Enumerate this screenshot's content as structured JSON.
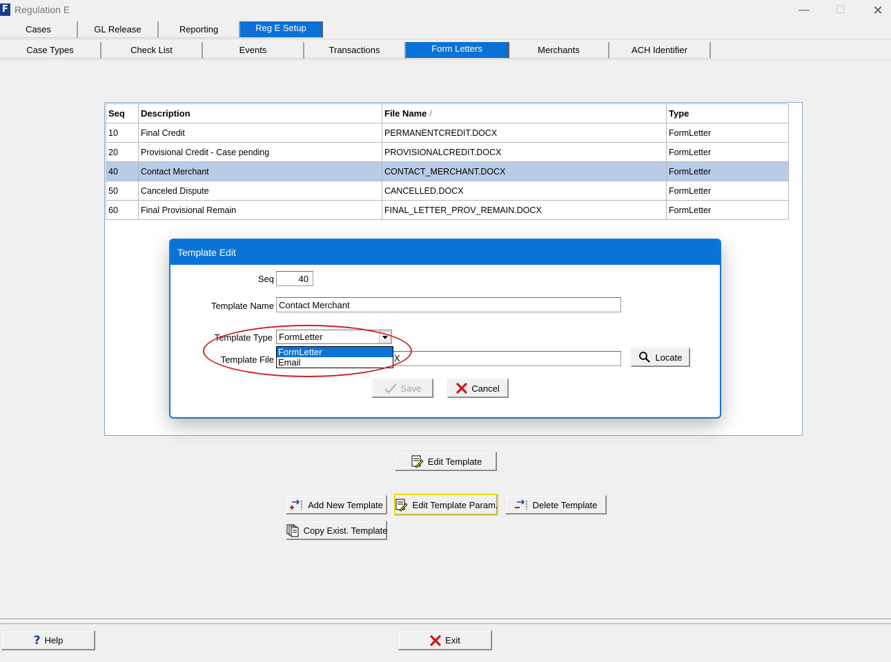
{
  "window": {
    "title": "Regulation E",
    "icon_letter": "F",
    "controls": {
      "minimize": "—",
      "maximize": "☐",
      "close": "✕"
    }
  },
  "main_tabs": [
    {
      "label": "Cases",
      "active": false
    },
    {
      "label": "GL Release",
      "active": false
    },
    {
      "label": "Reporting",
      "active": false
    },
    {
      "label": "Reg E Setup",
      "active": true
    }
  ],
  "sub_tabs": [
    {
      "label": "Case Types",
      "active": false
    },
    {
      "label": "Check List",
      "active": false
    },
    {
      "label": "Events",
      "active": false
    },
    {
      "label": "Transactions",
      "active": false
    },
    {
      "label": "Form Letters",
      "active": true
    },
    {
      "label": "Merchants",
      "active": false
    },
    {
      "label": "ACH Identifier",
      "active": false
    }
  ],
  "grid": {
    "columns": {
      "seq": "Seq",
      "description": "Description",
      "file_name": "File Name",
      "type": "Type"
    },
    "sort_indicator": "/",
    "rows": [
      {
        "seq": "10",
        "description": "Final Credit",
        "file_name": "PERMANENTCREDIT.DOCX",
        "type": "FormLetter",
        "selected": false
      },
      {
        "seq": "20",
        "description": "Provisional Credit - Case pending",
        "file_name": "PROVISIONALCREDIT.DOCX",
        "type": "FormLetter",
        "selected": false
      },
      {
        "seq": "40",
        "description": "Contact Merchant",
        "file_name": "CONTACT_MERCHANT.DOCX",
        "type": "FormLetter",
        "selected": true
      },
      {
        "seq": "50",
        "description": "Canceled Dispute",
        "file_name": "CANCELLED.DOCX",
        "type": "FormLetter",
        "selected": false
      },
      {
        "seq": "60",
        "description": "Final Provisional Remain",
        "file_name": "FINAL_LETTER_PROV_REMAIN.DOCX",
        "type": "FormLetter",
        "selected": false
      }
    ]
  },
  "dialog": {
    "title": "Template Edit",
    "seq_label": "Seq",
    "seq_value": "40",
    "name_label": "Template Name",
    "name_value": "Contact Merchant",
    "type_label": "Template Type",
    "type_value": "FormLetter",
    "type_options": [
      "FormLetter",
      "Email"
    ],
    "file_label": "Template File",
    "file_value_visible": "X",
    "locate_button": "Locate",
    "save_button": "Save",
    "cancel_button": "Cancel"
  },
  "actions": {
    "edit_template": "Edit Template",
    "add_new_template": "Add New Template",
    "edit_template_param": "Edit Template Param.",
    "delete_template": "Delete Template",
    "copy_exist_template": "Copy Exist. Template"
  },
  "footer": {
    "help_button": "Help",
    "exit_button": "Exit"
  },
  "colors": {
    "accent": "#0a74d6",
    "selected_row": "#b9cbe6",
    "highlight_circle": "#d0201f",
    "focus_border": "#e8dc00"
  }
}
